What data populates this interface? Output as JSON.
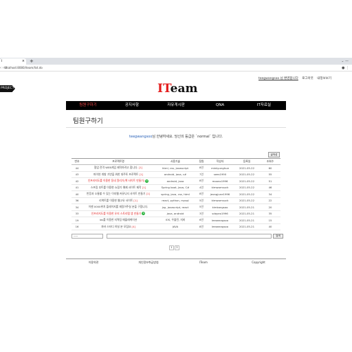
{
  "browser": {
    "tab_label": "i",
    "tab_close": "×",
    "new_tab": "+",
    "window_controls": "⌄  —",
    "nav_buttons": "‹ › ⟳",
    "url": "localhost:8080/iteam/list.do",
    "addr_right": "● ⋮"
  },
  "project_tag": "PROJECT",
  "usernav": {
    "user": "teegwangsoo 님 환영합니다",
    "logout": "로그아웃",
    "mypage": "내정보보기"
  },
  "logo": {
    "prefix": "IT",
    "suffix": "eam"
  },
  "nav": [
    "팀원구하기",
    "공지사항",
    "자유게시판",
    "QNA",
    "IT자료실"
  ],
  "page_title": "팀원구하기",
  "welcome": {
    "uid": "teegwangsoo",
    "text": "님 안녕하세요. 당신의 등급은 `normal` 입니다."
  },
  "write_button": "글작성",
  "table": {
    "headers": [
      "번호",
      "프로젝트명",
      "사용기술",
      "정원",
      "작성자",
      "등록일",
      "조회수"
    ],
    "rows": [
      {
        "no": "44",
        "title": "협업 전격 WEB게임 제작하려고 합니다.",
        "count": "[1]",
        "tech": "html, css, javascript",
        "cap": "8인",
        "writer": "minkyunghue",
        "date": "2021-05-22",
        "views": "60",
        "red": false,
        "new": false
      },
      {
        "no": "43",
        "title": "파이썬 개발 기반을 위한 대주토 프로젝트",
        "count": "[1]",
        "tech": "android, java, c#",
        "cap": "7인",
        "writer": "sees1990",
        "date": "2021-05-22",
        "views": "55",
        "red": false,
        "new": false
      },
      {
        "no": "42",
        "title": "인프라지도를 이용한 동네 알리기(책 사이트 만들기)",
        "count": "",
        "tech": "android, java",
        "cap": "8인",
        "writer": "moono1996",
        "date": "2021-05-22",
        "views": "51",
        "red": true,
        "new": true
      },
      {
        "no": "41",
        "title": "스프링 부트를 이용한 쇼핑기 예제 사이트 제작",
        "count": "[1]",
        "tech": "Spring boot, Java, C#",
        "cap": "4인",
        "writer": "kimwomsuck",
        "date": "2021-05-22",
        "views": "46",
        "red": false,
        "new": false
      },
      {
        "no": "40",
        "title": "반응과 소통할 수 있는 이지웹 커뮤니티 사이트 만들기",
        "count": "[1]",
        "tech": "spring, java, css, html",
        "cap": "8인",
        "writer": "jeongjune1996",
        "date": "2021-05-22",
        "views": "34",
        "red": false,
        "new": false
      },
      {
        "no": "36",
        "title": "리액트를 이용한 웹고유 사이트",
        "count": "[1]",
        "tech": "react, python, mysql",
        "cap": "5인",
        "writer": "kimwomsuck",
        "date": "2021-05-22",
        "views": "22",
        "red": false,
        "new": false
      },
      {
        "no": "34",
        "title": "이젠 0000위치 플레이지를 재밌어주실 분을 구합니다.",
        "count": "",
        "tech": "jsp, javascript, react",
        "cap": "5인",
        "writer": "kimkangsoo",
        "date": "2021-05-21",
        "views": "20",
        "red": false,
        "new": false
      },
      {
        "no": "33",
        "title": "인프라지도를 이용한 유지 스토리맵 앱 만들기",
        "count": "",
        "tech": "java, android",
        "cap": "3인",
        "writer": "sdayeo1996",
        "date": "2021-05-21",
        "views": "35",
        "red": true,
        "new": true
      },
      {
        "no": "19",
        "title": "ios를 이용한 지역팀 매물레케이션",
        "count": "",
        "tech": "IOS, 우블린, 지비",
        "cap": "6인",
        "writer": "leeoeangsoo",
        "date": "2021-05-21",
        "views": "15",
        "red": false,
        "new": false
      },
      {
        "no": "16",
        "title": "자바 스터디 하실 분 모집요",
        "count": "[4]",
        "tech": "JAVA",
        "cap": "8인",
        "writer": "leeoeangsoo",
        "date": "2021-05-21",
        "views": "40",
        "red": false,
        "new": false
      }
    ]
  },
  "search": {
    "select": "-----",
    "button": "검색"
  },
  "pager": [
    "1",
    "2"
  ],
  "footer": [
    "이용약관",
    "개인정보취급방침",
    "ITeam",
    "Copyright"
  ]
}
